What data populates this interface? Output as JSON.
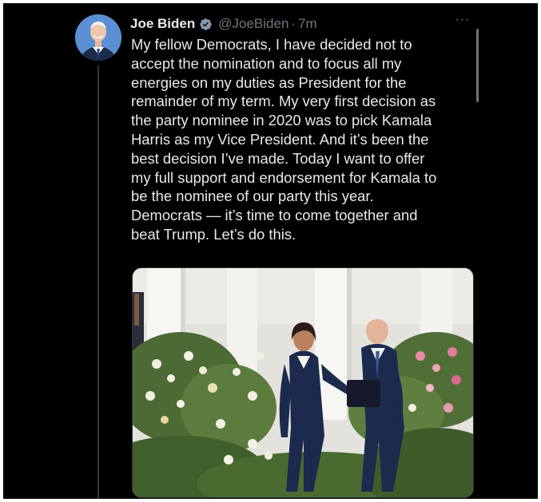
{
  "tweet": {
    "author_name": "Joe Biden",
    "handle": "@JoeBiden",
    "separator": "·",
    "time": "7m",
    "more_label": "···",
    "lines": [
      "My fellow Democrats, I have decided not to",
      "accept the nomination and to focus all my",
      "energies on my duties as President for the",
      "remainder of my term. My very first decision as",
      "the party nominee in 2020 was to pick Kamala",
      "Harris as my Vice President. And it’s been the",
      "best decision I’ve made. Today I want to offer",
      "my full support and endorsement for Kamala to",
      "be the nominee of our party this year.",
      "Democrats — it’s time to come together and",
      "beat Trump. Let’s do this."
    ]
  },
  "icons": {
    "verified": "verified-badge-icon",
    "more": "more-options-icon"
  },
  "colors": {
    "background": "#000000",
    "primary_text": "#e7e9ea",
    "secondary_text": "#71767b",
    "verified_badge": "#829aab",
    "thread_line": "#333639"
  }
}
